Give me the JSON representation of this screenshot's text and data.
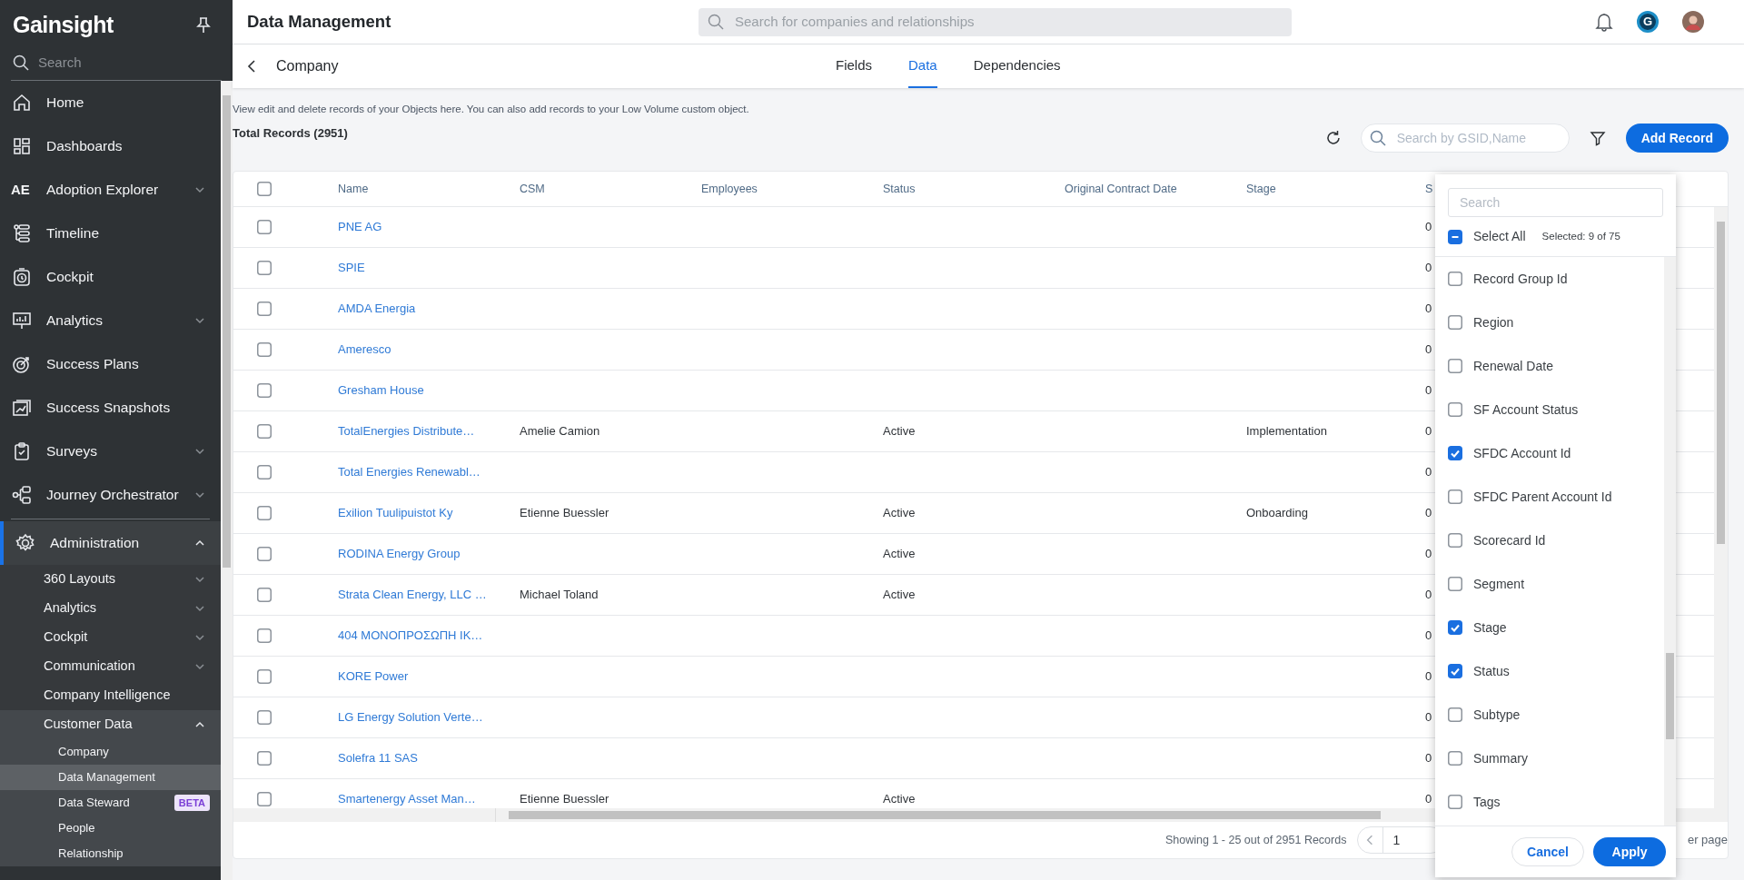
{
  "sidebar": {
    "logo": "Gainsight",
    "search_placeholder": "Search",
    "items": [
      {
        "label": "Home",
        "kind": "link",
        "selected": false
      },
      {
        "label": "Dashboards",
        "kind": "link",
        "selected": false
      },
      {
        "label": "Adoption Explorer",
        "icon_text": "AE",
        "kind": "group",
        "expanded": false,
        "selected": false
      },
      {
        "label": "Timeline",
        "kind": "link",
        "selected": false
      },
      {
        "label": "Cockpit",
        "kind": "link",
        "selected": false
      },
      {
        "label": "Analytics",
        "kind": "group",
        "expanded": false,
        "selected": false
      },
      {
        "label": "Success Plans",
        "kind": "link",
        "selected": false
      },
      {
        "label": "Success Snapshots",
        "kind": "link",
        "selected": false
      },
      {
        "label": "Surveys",
        "kind": "group",
        "expanded": false,
        "selected": false
      },
      {
        "label": "Journey Orchestrator",
        "kind": "group",
        "expanded": false,
        "selected": false
      },
      {
        "label": "Administration",
        "kind": "group",
        "expanded": true,
        "selected": true,
        "children": [
          {
            "label": "360 Layouts",
            "kind": "group",
            "expanded": false
          },
          {
            "label": "Analytics",
            "kind": "group",
            "expanded": false
          },
          {
            "label": "Cockpit",
            "kind": "group",
            "expanded": false
          },
          {
            "label": "Communication",
            "kind": "group",
            "expanded": false
          },
          {
            "label": "Company Intelligence",
            "kind": "link"
          },
          {
            "label": "Customer Data",
            "kind": "group",
            "expanded": true,
            "children": [
              {
                "label": "Company",
                "selected": false
              },
              {
                "label": "Data Management",
                "selected": true
              },
              {
                "label": "Data Steward",
                "badge": "BETA",
                "selected": false
              },
              {
                "label": "People",
                "selected": false
              },
              {
                "label": "Relationship",
                "selected": false
              }
            ]
          }
        ]
      }
    ]
  },
  "header": {
    "title": "Data Management",
    "search_placeholder": "Search for companies and relationships",
    "product_badge": "G"
  },
  "subheader": {
    "title": "Company",
    "tabs": [
      {
        "label": "Fields",
        "selected": false
      },
      {
        "label": "Data",
        "selected": true
      },
      {
        "label": "Dependencies",
        "selected": false
      }
    ]
  },
  "description": "View edit and delete records of your Objects here. You can also add records to your Low Volume custom object.",
  "total_records": "Total Records (2951)",
  "toolbar": {
    "search_placeholder": "Search by GSID,Name",
    "add_button": "Add Record"
  },
  "table": {
    "all_checked": false,
    "columns": [
      "Name",
      "CSM",
      "Employees",
      "Status",
      "Original Contract Date",
      "Stage",
      "S"
    ],
    "rows": [
      {
        "checked": false,
        "name": "PNE AG",
        "column_8": "0"
      },
      {
        "checked": false,
        "name": "SPIE",
        "column_8": "0"
      },
      {
        "checked": false,
        "name": "AMDA Energia",
        "column_8": "0"
      },
      {
        "checked": false,
        "name": "Ameresco",
        "column_8": "0"
      },
      {
        "checked": false,
        "name": "Gresham House",
        "column_8": "0"
      },
      {
        "checked": false,
        "name": "TotalEnergies Distribute…",
        "csm": "Amelie Camion",
        "status": "Active",
        "stage": "Implementation",
        "column_8": "0"
      },
      {
        "checked": false,
        "name": "Total Energies Renewabl…",
        "column_8": "0"
      },
      {
        "checked": false,
        "name": "Exilion Tuulipuistot Ky",
        "csm": "Etienne Buessler",
        "status": "Active",
        "stage": "Onboarding",
        "column_8": "0"
      },
      {
        "checked": false,
        "name": "RODINA Energy Group",
        "status": "Active",
        "column_8": "0"
      },
      {
        "checked": false,
        "name": "Strata Clean Energy, LLC …",
        "csm": "Michael Toland",
        "status": "Active",
        "column_8": "0"
      },
      {
        "checked": false,
        "name": "404 ΜΟΝΟΠΡΟΣΩΠΗ ΙΚ…",
        "column_8": "0"
      },
      {
        "checked": false,
        "name": "KORE Power",
        "column_8": "0"
      },
      {
        "checked": false,
        "name": "LG Energy Solution Verte…",
        "column_8": "0"
      },
      {
        "checked": false,
        "name": "Solefra 11 SAS",
        "column_8": "0"
      },
      {
        "checked": false,
        "name": "Smartenergy Asset Man…",
        "csm": "Etienne Buessler",
        "status": "Active",
        "column_8": "0"
      }
    ]
  },
  "footer": {
    "showing": "Showing 1 - 25 out of 2951 Records",
    "page": "1",
    "per_page": "er page"
  },
  "column_picker": {
    "search_placeholder": "Search",
    "select_all": {
      "label": "Select All",
      "checked": false,
      "indeterminate": true
    },
    "selected_count": "Selected: 9 of 75",
    "options": [
      {
        "label": "Record Group Id",
        "checked": false
      },
      {
        "label": "Region",
        "checked": false
      },
      {
        "label": "Renewal Date",
        "checked": false
      },
      {
        "label": "SF Account Status",
        "checked": false
      },
      {
        "label": "SFDC Account Id",
        "checked": true
      },
      {
        "label": "SFDC Parent Account Id",
        "checked": false
      },
      {
        "label": "Scorecard Id",
        "checked": false
      },
      {
        "label": "Segment",
        "checked": false
      },
      {
        "label": "Stage",
        "checked": true
      },
      {
        "label": "Status",
        "checked": true
      },
      {
        "label": "Subtype",
        "checked": false
      },
      {
        "label": "Summary",
        "checked": false
      },
      {
        "label": "Tags",
        "checked": false
      }
    ],
    "cancel": "Cancel",
    "apply": "Apply"
  }
}
